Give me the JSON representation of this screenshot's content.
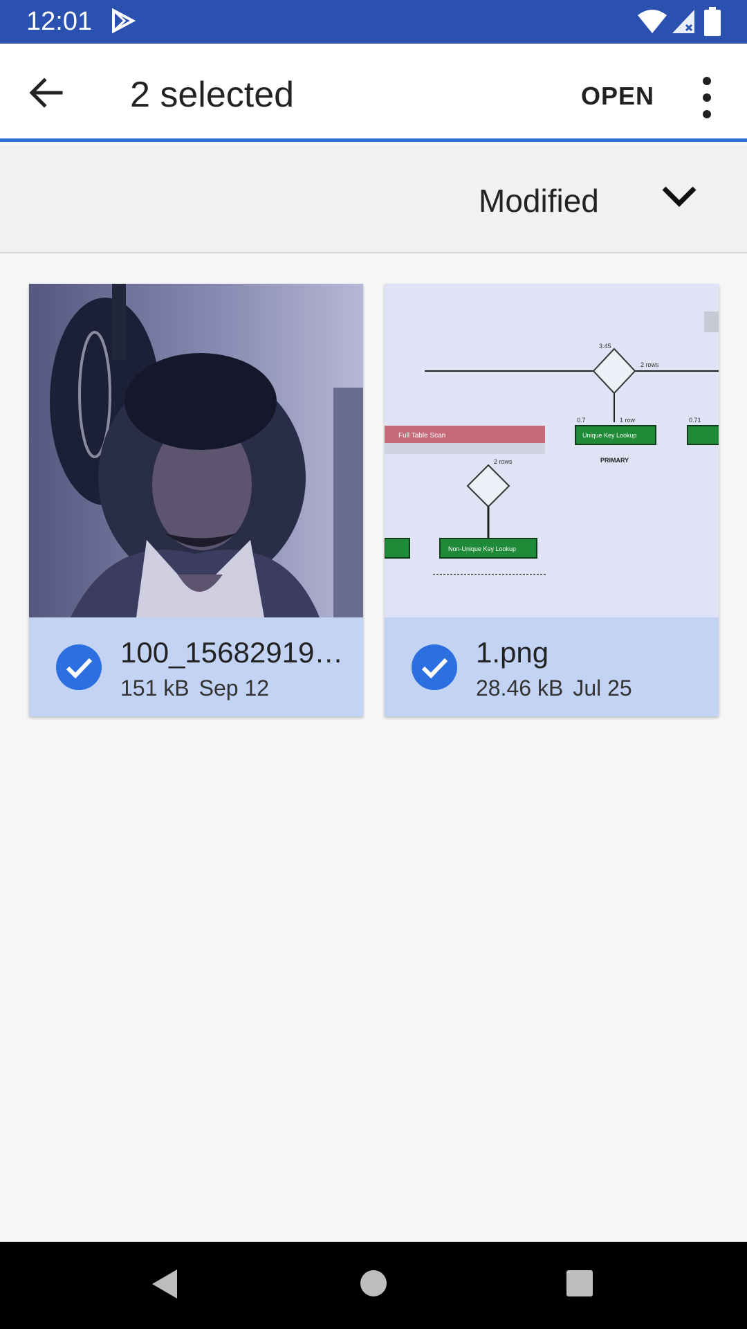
{
  "status_bar": {
    "time": "12:01"
  },
  "app_bar": {
    "title": "2 selected",
    "open_label": "OPEN"
  },
  "sort": {
    "label": "Modified"
  },
  "files": [
    {
      "name": "100_15682919…",
      "size": "151 kB",
      "date": "Sep 12",
      "selected": true
    },
    {
      "name": "1.png",
      "size": "28.46 kB",
      "date": "Jul 25",
      "selected": true
    }
  ],
  "thumbnail_text": {
    "full_table_scan": "Full Table Scan",
    "unique_key_lookup": "Unique Key Lookup",
    "non_unique_key_lookup": "Non-Unique Key Lookup",
    "primary": "PRIMARY",
    "rows_1": "2 rows",
    "rows_2": "1 row",
    "rows_3": "2 rows",
    "val_1": "3.45",
    "val_2": "0.7",
    "val_3": "0.71"
  },
  "colors": {
    "status_bar": "#2a50b0",
    "accent": "#2d6fd6",
    "selected_card": "#c3d3f4",
    "check": "#2b6fe0"
  }
}
